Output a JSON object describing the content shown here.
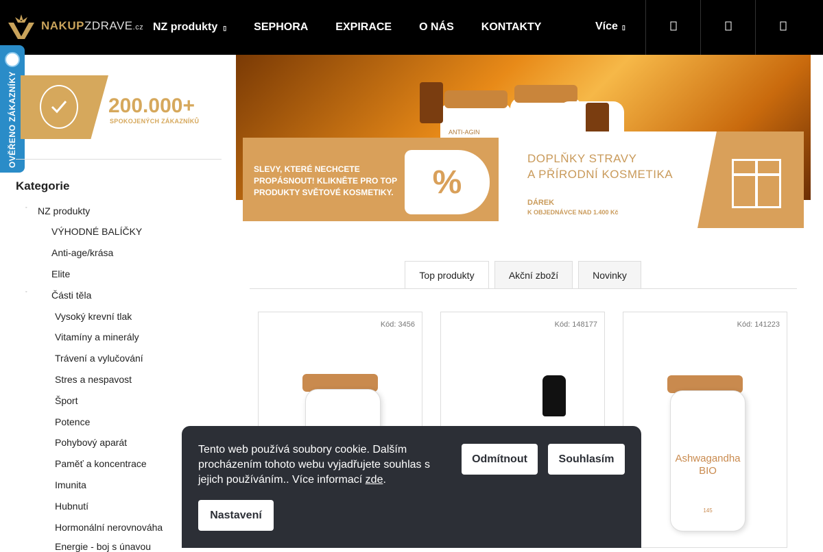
{
  "header": {
    "logo_text_bold": "NAKUP",
    "logo_text_thin": "ZDRAVE",
    "logo_text_tld": ".cz",
    "nav": [
      {
        "label": "NZ produkty",
        "has_caret": true
      },
      {
        "label": "SEPHORA"
      },
      {
        "label": "EXPIRACE"
      },
      {
        "label": "O NÁS"
      },
      {
        "label": "KONTAKTY"
      }
    ],
    "more_label": "Více",
    "icons": [
      "search-icon",
      "user-icon",
      "cart-icon"
    ]
  },
  "verified": {
    "label": "OVĚŘENO ZÁKAZNÍKY"
  },
  "customers_banner": {
    "count": "200.000+",
    "subtitle": "SPOKOJENÝCH ZÁKAZNÍKŮ"
  },
  "sidebar": {
    "title": "Kategorie",
    "items": [
      {
        "label": "NZ produkty"
      },
      {
        "label": "VÝHODNÉ BALÍČKY"
      },
      {
        "label": "Anti-age/krása"
      },
      {
        "label": "Elite"
      },
      {
        "label": "Části těla"
      },
      {
        "label": "Vysoký krevní tlak"
      },
      {
        "label": "Vitamíny a minerály"
      },
      {
        "label": "Trávení a vylučování"
      },
      {
        "label": "Stres a nespavost"
      },
      {
        "label": "Šport"
      },
      {
        "label": "Potence"
      },
      {
        "label": "Pohybový aparát"
      },
      {
        "label": "Paměť a koncentrace"
      },
      {
        "label": "Imunita"
      },
      {
        "label": "Hubnutí"
      },
      {
        "label": "Hormonální nerovnováha"
      },
      {
        "label": "Energie - boj s únavou"
      }
    ]
  },
  "hero": {
    "bottle_label": "ANTI-AGIN"
  },
  "promo_left": {
    "text": "SLEVY, KTERÉ NECHCETE PROPÁSNOUT! KLIKNĚTE PRO TOP PRODUKTY SVĚTOVÉ KOSMETIKY.",
    "tag": "%"
  },
  "promo_right": {
    "title_line1": "DOPLŇKY STRAVY",
    "title_line2": "A PŘÍRODNÍ KOSMETIKA",
    "gift_line1": "DÁREK",
    "gift_line2": "K OBJEDNÁVCE NAD 1.400 Kč"
  },
  "tabs": [
    {
      "label": "Top produkty",
      "active": true
    },
    {
      "label": "Akční zboží",
      "active": false
    },
    {
      "label": "Novinky",
      "active": false
    }
  ],
  "products": [
    {
      "code": "Kód: 3456"
    },
    {
      "code": "Kód: 148177"
    },
    {
      "code": "Kód: 141223",
      "jar_label_1": "Ashwagandha",
      "jar_label_2": "BIO",
      "jar_count": "145"
    }
  ],
  "cookie": {
    "text": "Tento web používá soubory cookie. Dalším procházením tohoto webu vyjadřujete souhlas s jejich používáním.. Více informací",
    "link": "zde",
    "end": ".",
    "decline": "Odmítnout",
    "accept": "Souhlasím",
    "settings": "Nastavení"
  },
  "colors": {
    "brand_gold": "#d6a85c",
    "verified_blue": "#2a8cc8",
    "cookie_bg": "#2c2f36"
  }
}
